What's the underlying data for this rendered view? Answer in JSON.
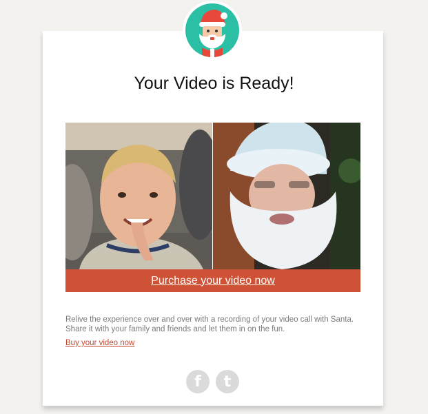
{
  "email": {
    "logo_icon": "santa-face-icon",
    "title": "Your Video is Ready!",
    "video_preview": {
      "left_person": "child",
      "right_person": "santa"
    },
    "purchase_link": "Purchase your video now",
    "description": "Relive the experience over and over with a recording of your video call with Santa. Share it with your family and friends and let them in on the fun.",
    "buy_link": "Buy your video now",
    "social": [
      {
        "icon": "facebook-icon",
        "glyph": "f"
      },
      {
        "icon": "twitter-icon",
        "glyph": "t"
      }
    ]
  },
  "colors": {
    "page_background": "#f4f2ef",
    "card_background": "#ffffff",
    "logo_teal": "#2bbfa5",
    "accent_red": "#ce5235",
    "link_red": "#c4472c",
    "social_grey": "#dadada"
  }
}
